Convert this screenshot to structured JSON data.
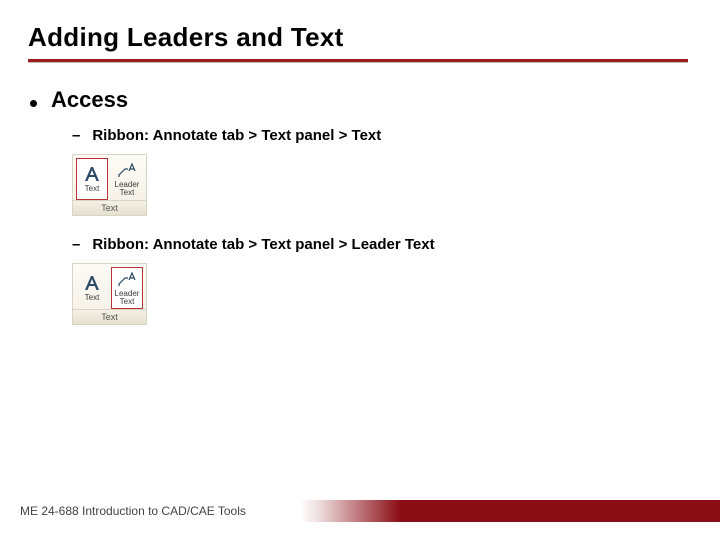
{
  "title": "Adding Leaders and Text",
  "section": "Access",
  "items": [
    {
      "path": "Ribbon: Annotate tab > Text panel > Text",
      "panel_caption": "Text",
      "buttons": [
        {
          "label": "Text",
          "selected": true
        },
        {
          "label": "Leader\nText",
          "selected": false
        }
      ]
    },
    {
      "path": "Ribbon: Annotate tab > Text panel > Leader Text",
      "panel_caption": "Text",
      "buttons": [
        {
          "label": "Text",
          "selected": false
        },
        {
          "label": "Leader\nText",
          "selected": true
        }
      ]
    }
  ],
  "footer": "ME 24-688 Introduction to CAD/CAE Tools"
}
